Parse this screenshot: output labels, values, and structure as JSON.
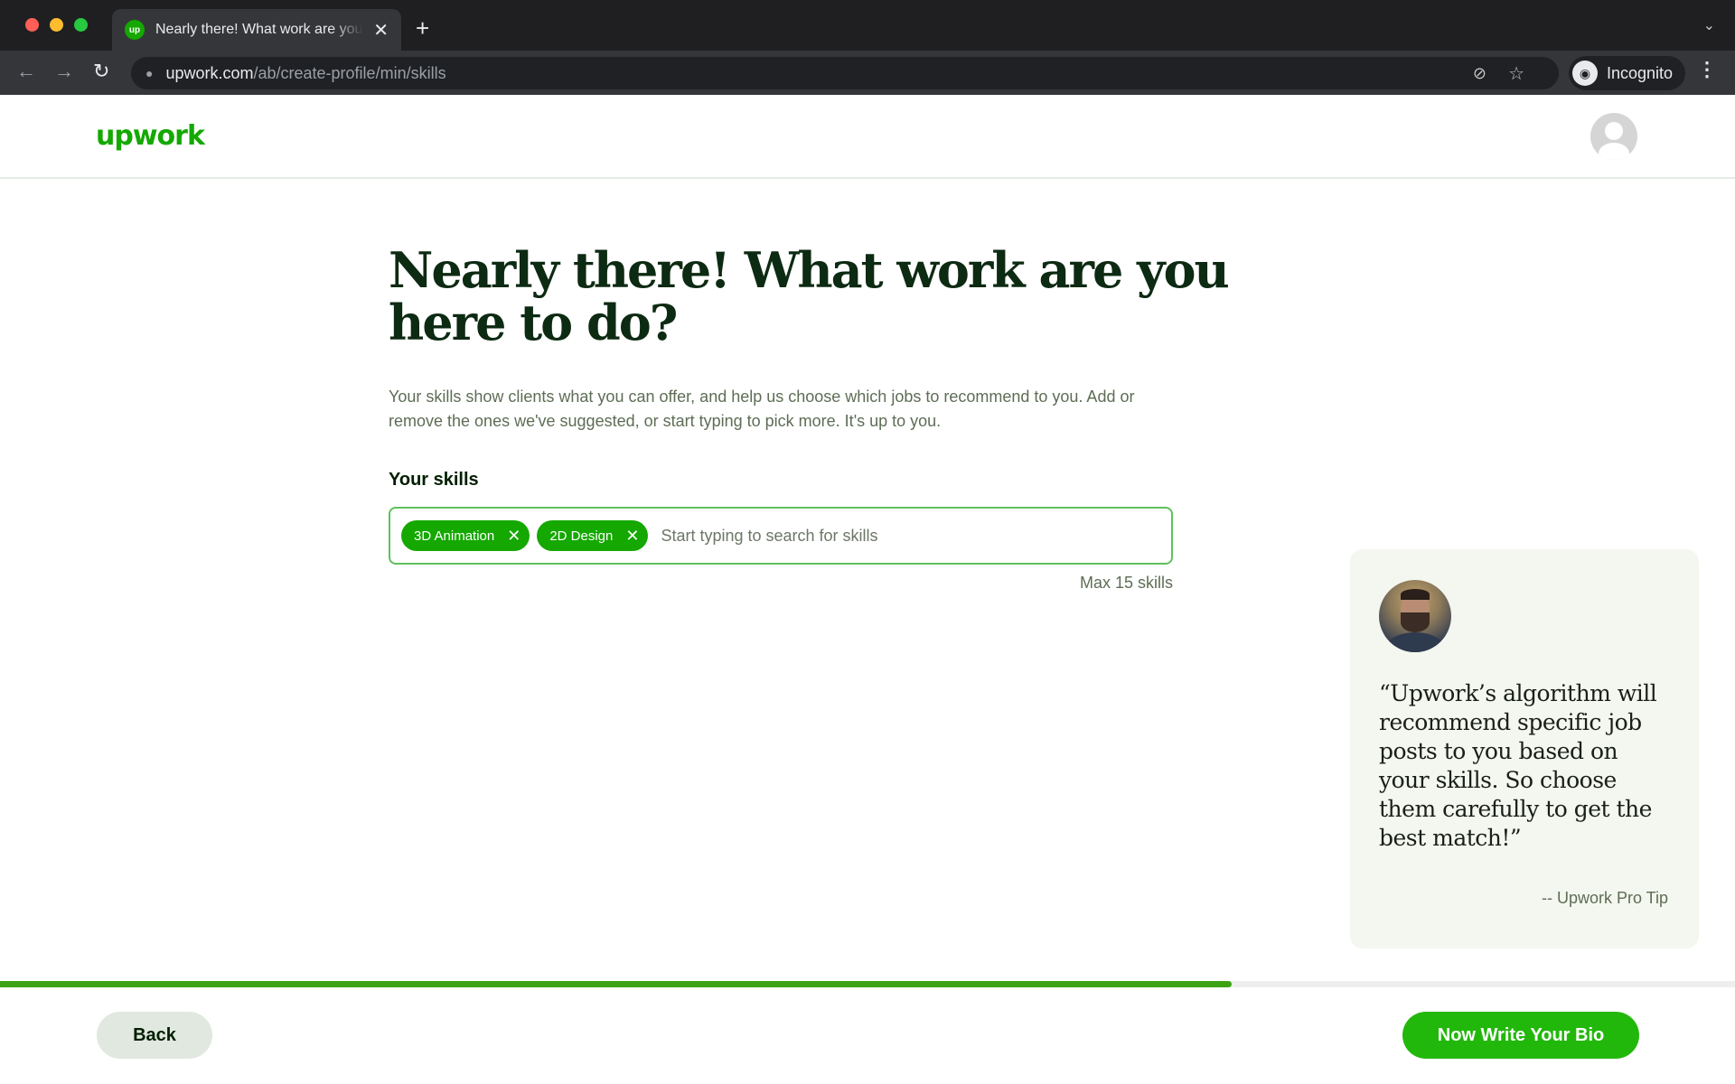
{
  "browser": {
    "tab_title": "Nearly there! What work are you here to do?",
    "favicon_text": "up",
    "url_host": "upwork.com",
    "url_path": "/ab/create-profile/min/skills",
    "incognito_label": "Incognito",
    "icons": {
      "back": "←",
      "forward": "→",
      "reload": "↻",
      "lock": "🔒",
      "eye_off": "⊘",
      "star": "☆",
      "incognito": "🕶",
      "kebab": "⋮",
      "new_tab": "+",
      "tab_close": "✕",
      "tab_menu": "⌄"
    }
  },
  "header": {
    "logo_text": "upwork",
    "brand_color": "#14a800"
  },
  "main": {
    "headline": "Nearly there! What work are you here to do?",
    "intro": "Your skills show clients what you can offer, and help us choose which jobs to recommend to you. Add or remove the ones we've suggested, or start typing to pick more. It's up to you.",
    "skills_label": "Your skills",
    "skills": [
      {
        "label": "3D Animation"
      },
      {
        "label": "2D Design"
      }
    ],
    "chip_remove_icon": "✕",
    "search_placeholder": "Start typing to search for skills",
    "search_value": "",
    "max_note": "Max 15 skills"
  },
  "tip": {
    "quote": "“Upwork’s algorithm will recommend specific job posts to you based on your skills. So choose them carefully to get the best match!”",
    "attribution": "-- Upwork Pro Tip"
  },
  "footer": {
    "progress_percent": 71,
    "back_label": "Back",
    "next_label": "Now Write Your Bio"
  }
}
